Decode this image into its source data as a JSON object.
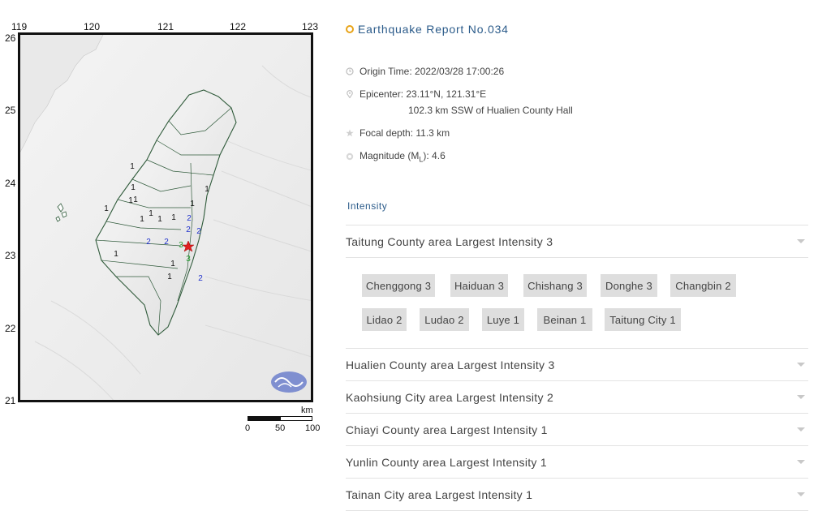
{
  "map": {
    "lon_ticks": [
      "119",
      "120",
      "121",
      "122",
      "123"
    ],
    "lat_ticks": [
      "26",
      "25",
      "24",
      "23",
      "22",
      "21"
    ],
    "intensity_marks": [
      {
        "label": "1",
        "color": "#111111"
      },
      {
        "label": "1",
        "color": "#111111"
      },
      {
        "label": "1",
        "color": "#111111"
      },
      {
        "label": "1",
        "color": "#111111"
      },
      {
        "label": "1",
        "color": "#111111"
      },
      {
        "label": "1",
        "color": "#111111"
      },
      {
        "label": "1",
        "color": "#111111"
      },
      {
        "label": "1",
        "color": "#111111"
      },
      {
        "label": "1",
        "color": "#111111"
      },
      {
        "label": "1",
        "color": "#111111"
      },
      {
        "label": "1",
        "color": "#111111"
      },
      {
        "label": "1",
        "color": "#111111"
      },
      {
        "label": "1",
        "color": "#111111"
      },
      {
        "label": "1",
        "color": "#111111"
      },
      {
        "label": "2",
        "color": "#2233cc"
      },
      {
        "label": "2",
        "color": "#2233cc"
      },
      {
        "label": "2",
        "color": "#2233cc"
      },
      {
        "label": "2",
        "color": "#2233cc"
      },
      {
        "label": "2",
        "color": "#2233cc"
      },
      {
        "label": "2",
        "color": "#2233cc"
      },
      {
        "label": "3",
        "color": "#1f9a2a"
      },
      {
        "label": "3",
        "color": "#1f9a2a"
      }
    ],
    "scale": {
      "unit": "km",
      "labels": [
        "0",
        "50",
        "100"
      ]
    }
  },
  "report": {
    "title": "Earthquake Report No.034",
    "origin_time": "Origin Time: 2022/03/28 17:00:26",
    "epicenter": "Epicenter: 23.11°N, 121.31°E",
    "epicenter_distance": "102.3 km SSW of Hualien County Hall",
    "focal_depth": "Focal depth: 11.3 km",
    "magnitude_prefix": "Magnitude (M",
    "magnitude_sub": "L",
    "magnitude_suffix": "): 4.6",
    "intensity_heading": "Intensity",
    "expanded_area": "Taitung County area Largest Intensity 3",
    "stations": [
      "Chenggong 3",
      "Haiduan 3",
      "Chishang 3",
      "Donghe 3",
      "Changbin 2",
      "Lidao 2",
      "Ludao 2",
      "Luye 1",
      "Beinan 1",
      "Taitung City 1"
    ],
    "other_areas": [
      "Hualien County area Largest Intensity 3",
      "Kaohsiung City area Largest Intensity 2",
      "Chiayi County area Largest Intensity 1",
      "Yunlin County area Largest Intensity 1",
      "Tainan City area Largest Intensity 1"
    ]
  },
  "colors": {
    "title": "#2b5b8a",
    "title_dot": "#e8a317",
    "epicenter_star": "#e02020",
    "chip_bg": "#dedede",
    "logo": "#7f8fd0"
  },
  "icons": [
    "clock-icon",
    "location-pin-icon",
    "star-icon",
    "magnitude-icon",
    "chevron-down-icon",
    "cwb-logo"
  ]
}
